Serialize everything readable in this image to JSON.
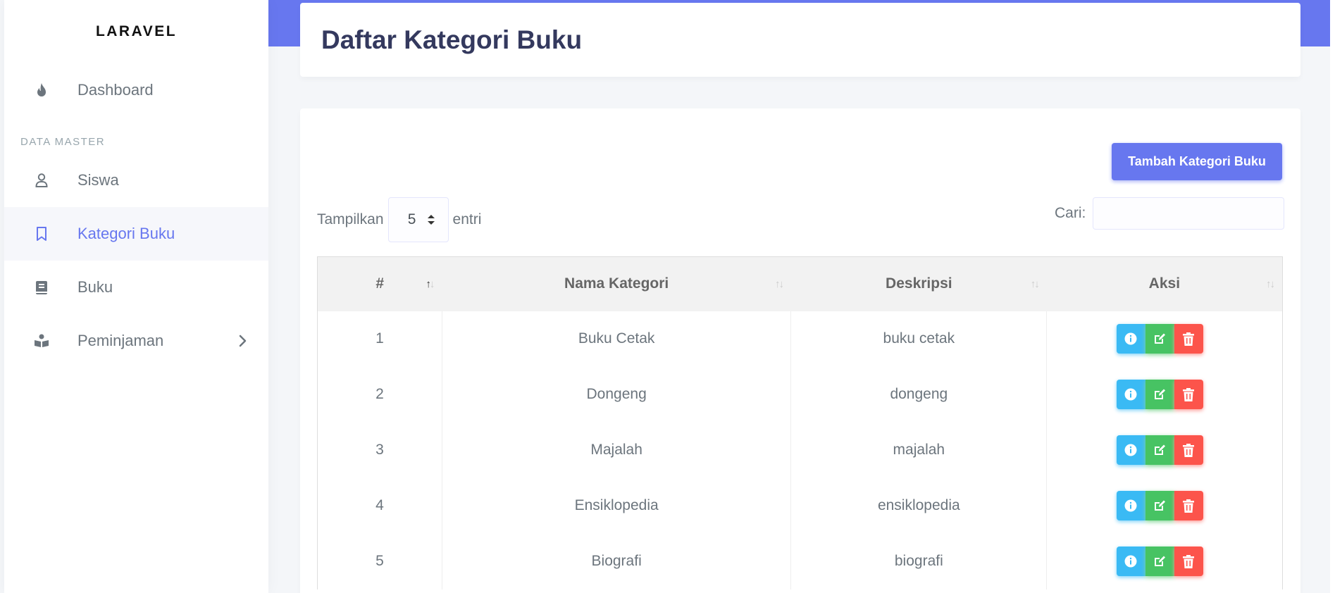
{
  "sidebar": {
    "brand": "LARAVEL",
    "items": [
      {
        "label": "Dashboard",
        "icon": "fire-icon"
      },
      {
        "label": "Siswa",
        "icon": "user-icon"
      },
      {
        "label": "Kategori Buku",
        "icon": "bookmark-icon",
        "active": true
      },
      {
        "label": "Buku",
        "icon": "book-icon"
      },
      {
        "label": "Peminjaman",
        "icon": "book-reader-icon"
      }
    ],
    "section_header": "DATA MASTER"
  },
  "page": {
    "title": "Daftar Kategori Buku"
  },
  "toolbar": {
    "add_label": "Tambah Kategori Buku",
    "show_label": "Tampilkan",
    "entries_label": "entri",
    "page_length": "5",
    "search_label": "Cari:",
    "search_value": ""
  },
  "table": {
    "headers": [
      "#",
      "Nama Kategori",
      "Deskripsi",
      "Aksi"
    ],
    "rows": [
      {
        "no": "1",
        "name": "Buku Cetak",
        "desc": "buku cetak"
      },
      {
        "no": "2",
        "name": "Dongeng",
        "desc": "dongeng"
      },
      {
        "no": "3",
        "name": "Majalah",
        "desc": "majalah"
      },
      {
        "no": "4",
        "name": "Ensiklopedia",
        "desc": "ensiklopedia"
      },
      {
        "no": "5",
        "name": "Biografi",
        "desc": "biografi"
      }
    ]
  },
  "colors": {
    "primary": "#6777ef",
    "info": "#3abaf4",
    "success": "#47c363",
    "danger": "#fc544b"
  }
}
